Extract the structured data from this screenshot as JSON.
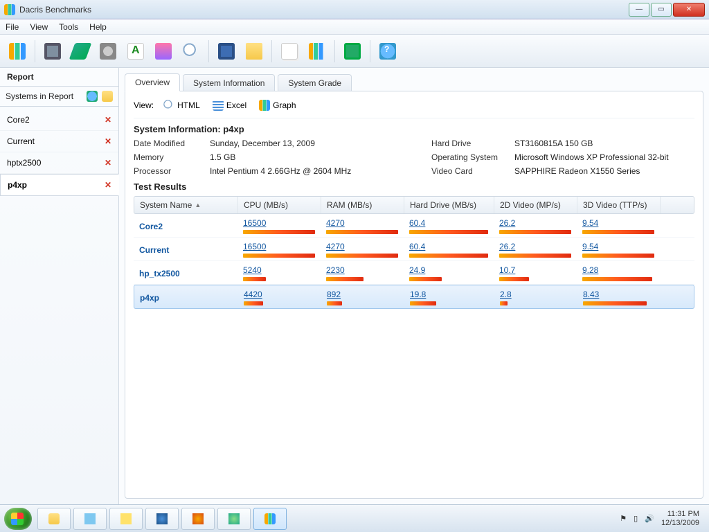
{
  "window": {
    "title": "Dacris Benchmarks"
  },
  "menu": {
    "file": "File",
    "view": "View",
    "tools": "Tools",
    "help": "Help"
  },
  "sidebar": {
    "heading": "Report",
    "subheading": "Systems in Report",
    "items": [
      {
        "name": "Core2"
      },
      {
        "name": "Current"
      },
      {
        "name": "hptx2500"
      },
      {
        "name": "p4xp"
      }
    ]
  },
  "tabs": {
    "overview": "Overview",
    "sysinfo": "System Information",
    "grade": "System Grade"
  },
  "viewrow": {
    "label": "View:",
    "html": "HTML",
    "excel": "Excel",
    "graph": "Graph"
  },
  "sysinfo": {
    "title": "System Information: p4xp",
    "date_k": "Date Modified",
    "date_v": "Sunday, December 13, 2009",
    "mem_k": "Memory",
    "mem_v": "1.5 GB",
    "proc_k": "Processor",
    "proc_v": "Intel Pentium 4 2.66GHz @ 2604 MHz",
    "hdd_k": "Hard Drive",
    "hdd_v": "ST3160815A 150 GB",
    "os_k": "Operating System",
    "os_v": "Microsoft Windows XP Professional 32-bit",
    "vid_k": "Video Card",
    "vid_v": "SAPPHIRE Radeon X1550 Series"
  },
  "results": {
    "title": "Test Results",
    "columns": {
      "name": "System Name",
      "cpu": "CPU (MB/s)",
      "ram": "RAM (MB/s)",
      "hdd": "Hard Drive (MB/s)",
      "v2d": "2D Video (MP/s)",
      "v3d": "3D Video (TTP/s)"
    },
    "rows": [
      {
        "name": "Core2",
        "cpu": "16500",
        "ram": "4270",
        "hdd": "60.4",
        "v2d": "26.2",
        "v3d": "9.54",
        "w": {
          "cpu": 100,
          "ram": 100,
          "hdd": 100,
          "v2d": 100,
          "v3d": 100
        }
      },
      {
        "name": "Current",
        "cpu": "16500",
        "ram": "4270",
        "hdd": "60.4",
        "v2d": "26.2",
        "v3d": "9.54",
        "w": {
          "cpu": 100,
          "ram": 100,
          "hdd": 100,
          "v2d": 100,
          "v3d": 100
        }
      },
      {
        "name": "hp_tx2500",
        "cpu": "5240",
        "ram": "2230",
        "hdd": "24.9",
        "v2d": "10.7",
        "v3d": "9.28",
        "w": {
          "cpu": 32,
          "ram": 52,
          "hdd": 41,
          "v2d": 41,
          "v3d": 97
        }
      },
      {
        "name": "p4xp",
        "cpu": "4420",
        "ram": "892",
        "hdd": "19.8",
        "v2d": "2.8",
        "v3d": "8.43",
        "w": {
          "cpu": 27,
          "ram": 21,
          "hdd": 33,
          "v2d": 11,
          "v3d": 88
        }
      }
    ]
  },
  "taskbar": {
    "time": "11:31 PM",
    "date": "12/13/2009"
  },
  "chart_data": {
    "type": "table",
    "title": "Test Results",
    "columns": [
      "System Name",
      "CPU (MB/s)",
      "RAM (MB/s)",
      "Hard Drive (MB/s)",
      "2D Video (MP/s)",
      "3D Video (TTP/s)"
    ],
    "rows": [
      [
        "Core2",
        16500,
        4270,
        60.4,
        26.2,
        9.54
      ],
      [
        "Current",
        16500,
        4270,
        60.4,
        26.2,
        9.54
      ],
      [
        "hp_tx2500",
        5240,
        2230,
        24.9,
        10.7,
        9.28
      ],
      [
        "p4xp",
        4420,
        892,
        19.8,
        2.8,
        8.43
      ]
    ]
  }
}
